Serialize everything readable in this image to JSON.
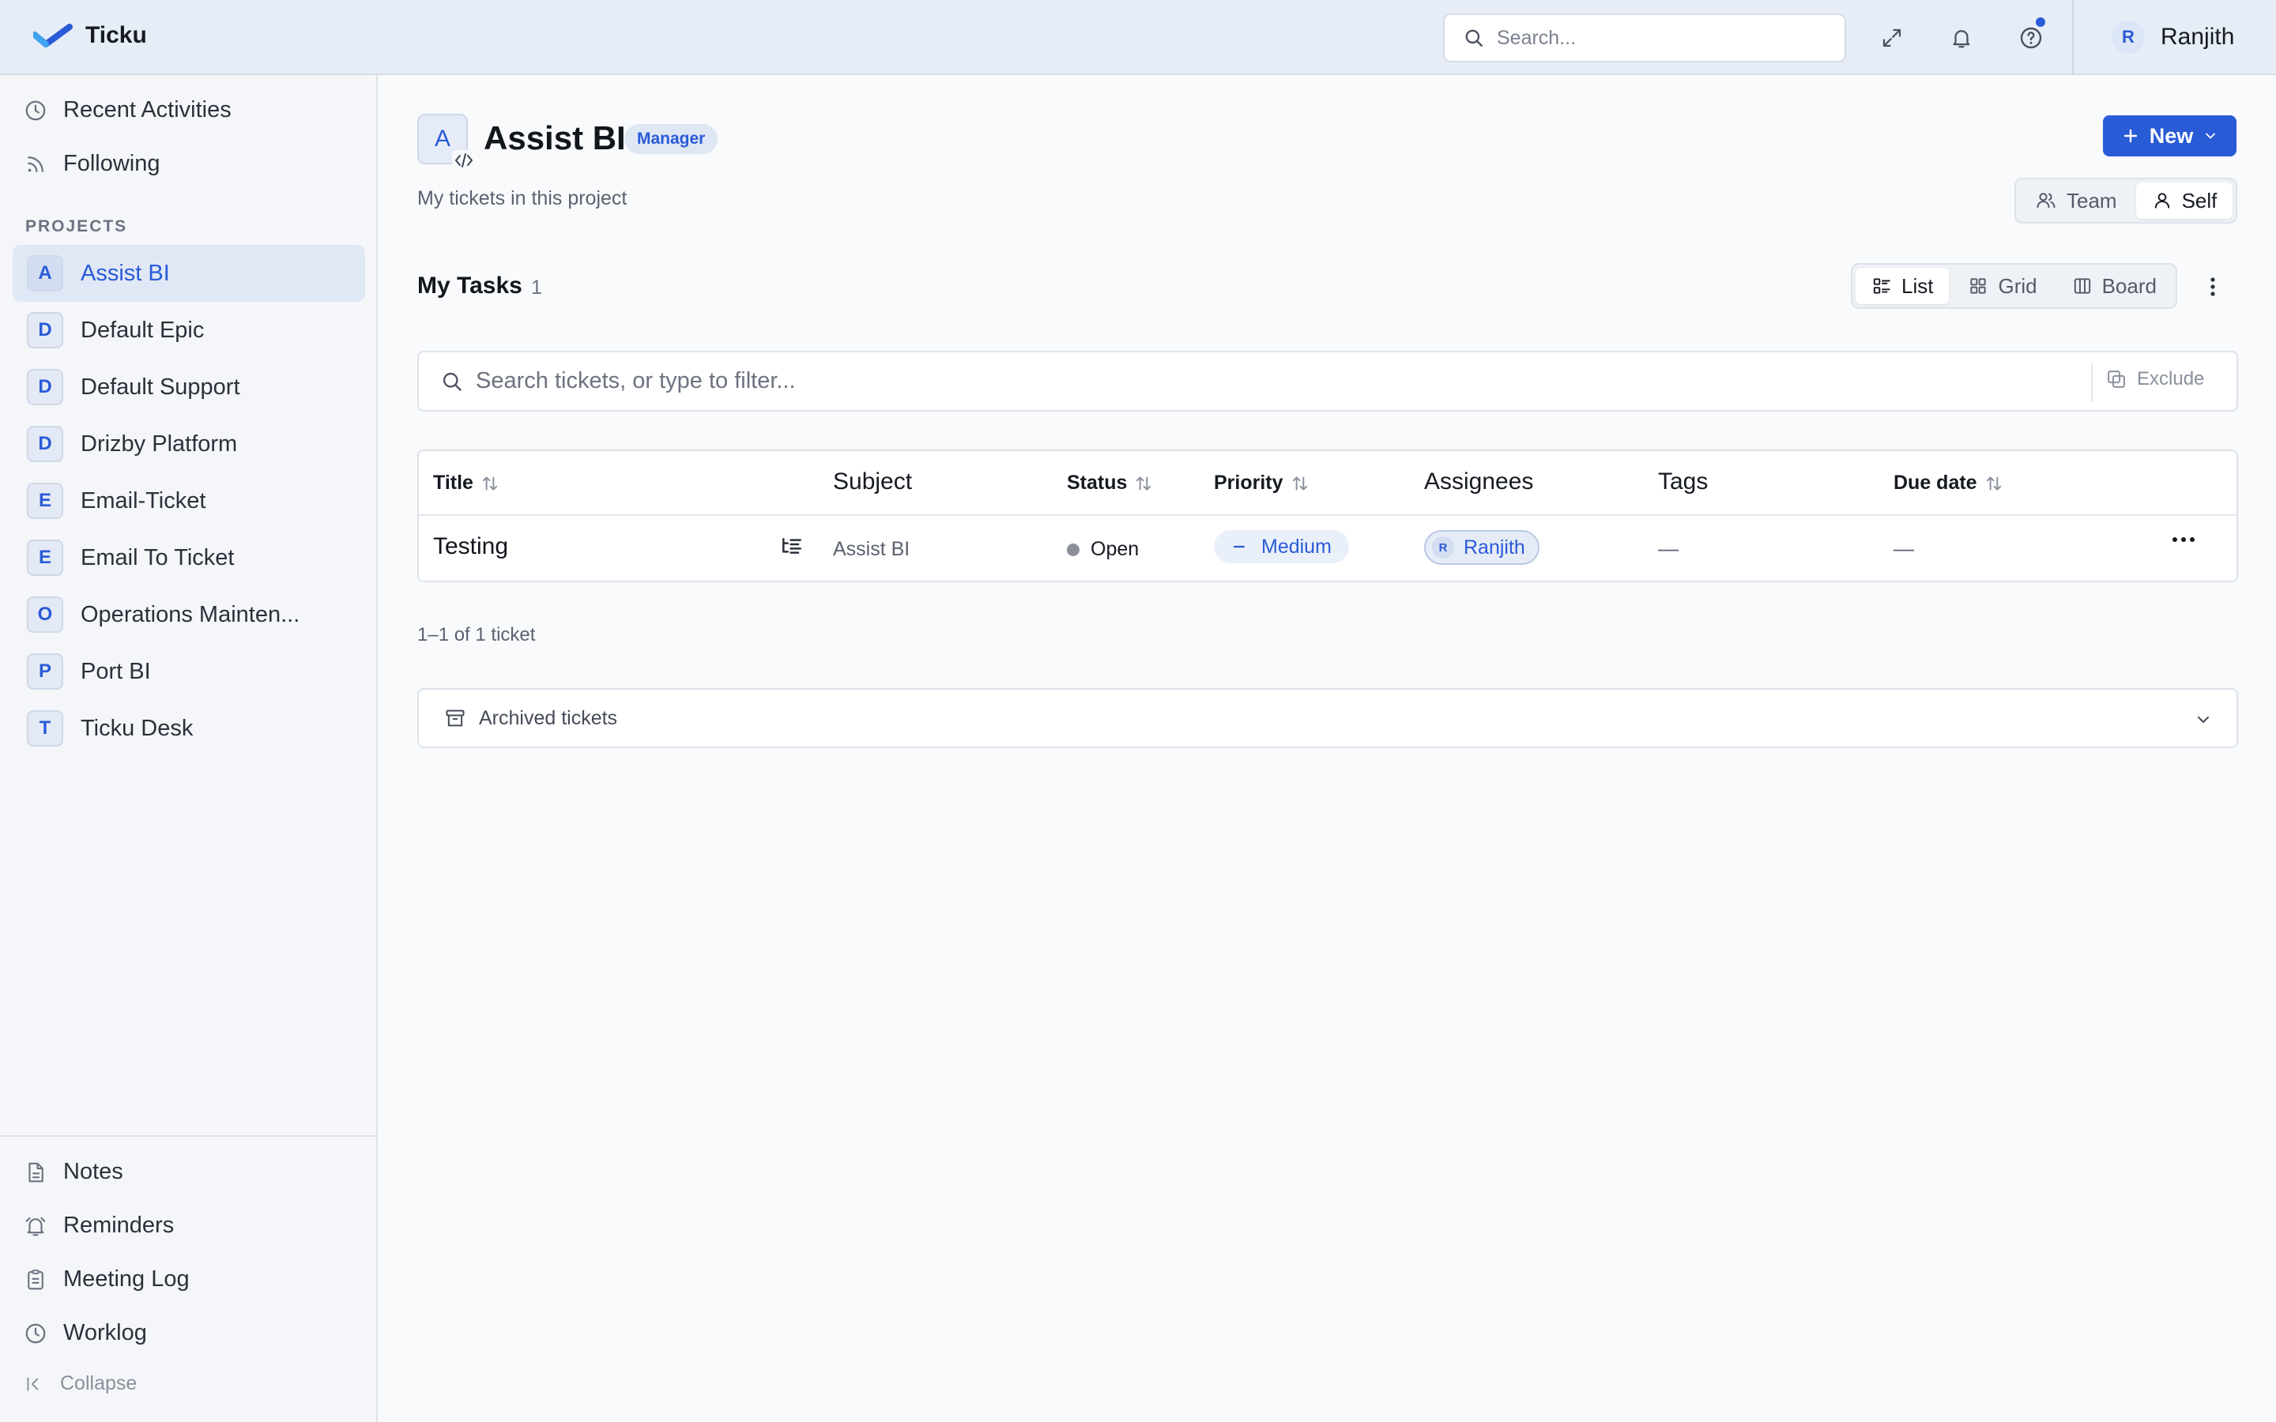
{
  "app": {
    "name": "Ticku"
  },
  "topbar": {
    "search_placeholder": "Search...",
    "user": {
      "initial": "R",
      "name": "Ranjith"
    }
  },
  "sidebar": {
    "top_items": [
      {
        "label": "Recent Activities",
        "icon": "clock-icon"
      },
      {
        "label": "Following",
        "icon": "rss-icon"
      }
    ],
    "projects_label": "PROJECTS",
    "projects": [
      {
        "initial": "A",
        "name": "Assist BI",
        "active": true
      },
      {
        "initial": "D",
        "name": "Default Epic"
      },
      {
        "initial": "D",
        "name": "Default Support"
      },
      {
        "initial": "D",
        "name": "Drizby Platform"
      },
      {
        "initial": "E",
        "name": "Email-Ticket"
      },
      {
        "initial": "E",
        "name": "Email To Ticket"
      },
      {
        "initial": "O",
        "name": "Operations Mainten..."
      },
      {
        "initial": "P",
        "name": "Port BI"
      },
      {
        "initial": "T",
        "name": "Ticku Desk"
      }
    ],
    "bottom_items": [
      {
        "label": "Notes",
        "icon": "file-icon"
      },
      {
        "label": "Reminders",
        "icon": "bell-icon"
      },
      {
        "label": "Meeting Log",
        "icon": "clipboard-icon"
      },
      {
        "label": "Worklog",
        "icon": "clock-icon"
      }
    ],
    "collapse_label": "Collapse"
  },
  "project": {
    "initial": "A",
    "title": "Assist BI",
    "role": "Manager",
    "subtitle": "My tickets in this project",
    "new_label": "New",
    "scope": {
      "team": "Team",
      "self": "Self",
      "active": "Self"
    }
  },
  "tasks": {
    "title": "My Tasks",
    "count": "1",
    "views": {
      "list": "List",
      "grid": "Grid",
      "board": "Board",
      "active": "List"
    },
    "filter_placeholder": "Search tickets, or type to filter...",
    "exclude_label": "Exclude",
    "columns": {
      "title": "Title",
      "subject": "Subject",
      "status": "Status",
      "priority": "Priority",
      "assignees": "Assignees",
      "tags": "Tags",
      "due": "Due date"
    },
    "rows": [
      {
        "title": "Testing",
        "subject": "Assist BI",
        "status": "Open",
        "priority": "Medium",
        "assignee_initial": "R",
        "assignee": "Ranjith",
        "tags": "—",
        "due": "—"
      }
    ],
    "pagination": "1–1 of 1 ticket",
    "archived_label": "Archived tickets"
  },
  "colors": {
    "accent": "#2a5bd7",
    "sidebar_bg": "#f4f6f9",
    "topbar_bg": "#e7edf6"
  }
}
